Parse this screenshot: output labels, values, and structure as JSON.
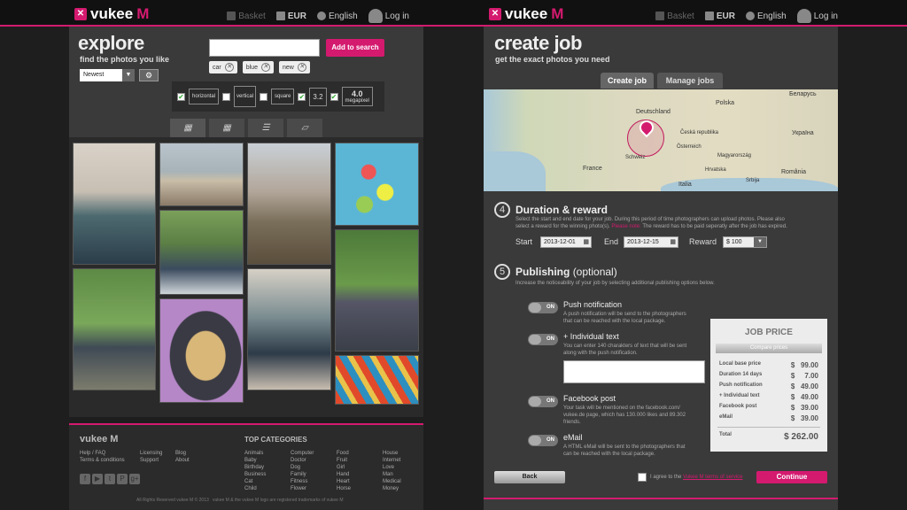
{
  "brand": {
    "name": "vukee",
    "m": "M",
    "mark": "✕",
    "accent": "#d41a6f"
  },
  "nav": {
    "basket": "Basket",
    "currency": "EUR",
    "language": "English",
    "login": "Log in"
  },
  "explore": {
    "title": "explore",
    "subtitle": "find the photos you like",
    "sort": "Newest",
    "search_value": "",
    "search_button": "Add to search",
    "tags": [
      "car",
      "blue",
      "new"
    ],
    "filters": {
      "horizontal": "horizontal",
      "vertical": "vertical",
      "square": "square",
      "ratio": "3.2",
      "megapixel_value": "4.0",
      "megapixel_label": "megapixel"
    }
  },
  "footer": {
    "brand": "vukee M",
    "col1": [
      "Help / FAQ",
      "Terms & conditions"
    ],
    "col2": [
      "Licensing",
      "Support"
    ],
    "col3": [
      "Blog",
      "About"
    ],
    "categories_title": "TOP CATEGORIES",
    "cat1": [
      "Animals",
      "Baby",
      "Birthday",
      "Business",
      "Cat",
      "Child"
    ],
    "cat2": [
      "Computer",
      "Doctor",
      "Dog",
      "Family",
      "Fitness",
      "Flower"
    ],
    "cat3": [
      "Food",
      "Fruit",
      "Girl",
      "Hand",
      "Heart",
      "Horse"
    ],
    "cat4": [
      "House",
      "Internet",
      "Love",
      "Man",
      "Medical",
      "Money"
    ],
    "social": [
      "f",
      "▶",
      "t",
      "P",
      "g+"
    ],
    "copyright": "All Rights Reserved vukee M © 2013",
    "trademark": "vukee M & the vukee M logo are registered trademarks of vukee M"
  },
  "job": {
    "title": "create job",
    "subtitle": "get the exact photos you need",
    "tab_create": "Create job",
    "tab_manage": "Manage jobs",
    "map_labels": [
      "Deutschland",
      "France",
      "Polska",
      "Česká republika",
      "Magyarország",
      "România",
      "Україна",
      "Беларусь",
      "Italia",
      "Schweiz",
      "Österreich",
      "Hrvatska",
      "Srbija"
    ],
    "duration": {
      "step": "4",
      "heading": "Duration & reward",
      "desc1": "Select the start and end date for your job. During this period of time photographers can upload photos. Please also",
      "desc2a": "select a reward for the winning photo(s).",
      "desc2b": "Please note:",
      "desc2c": "The reward has to be paid seperatly after the job has expired.",
      "start_label": "Start",
      "start_value": "2013-12-01",
      "end_label": "End",
      "end_value": "2013-12-15",
      "reward_label": "Reward",
      "reward_value": "$ 100"
    },
    "publishing": {
      "step": "5",
      "heading": "Publishing",
      "heading_opt": "(optional)",
      "desc": "Increase the noticeability of your job by selecting additional publishing options below."
    },
    "options": [
      {
        "toggle": "ON",
        "title": "Push notification",
        "desc": [
          "A push notification will be send to the photographers",
          "that can be reached with the local package."
        ]
      },
      {
        "toggle": "ON",
        "title": "+ Individual text",
        "desc": [
          "You can enter 140 charakters of text that will be sent",
          "along with the push notification."
        ]
      },
      {
        "toggle": "ON",
        "title": "Facebook post",
        "desc": [
          "Your task will be mentioned on the facebook.com/",
          "vukee.de page, which has 130.000 likes and 89.302",
          "friends."
        ]
      },
      {
        "toggle": "ON",
        "title": "eMail",
        "desc": [
          "A HTML eMail will be sent to the photographers that",
          "can be reached with the local package."
        ]
      }
    ],
    "price": {
      "title": "JOB PRICE",
      "compare": "Compare prices",
      "rows": [
        {
          "label": "Local base price",
          "cur": "$",
          "value": "99.00"
        },
        {
          "label": "Duration 14 days",
          "cur": "$",
          "value": "7.00"
        },
        {
          "label": "Push notification",
          "cur": "$",
          "value": "49.00"
        },
        {
          "label": "+ Individual text",
          "cur": "$",
          "value": "49.00"
        },
        {
          "label": "Facebook post",
          "cur": "$",
          "value": "39.00"
        },
        {
          "label": "eMail",
          "cur": "$",
          "value": "39.00"
        }
      ],
      "total_label": "Total",
      "total_value": "$ 262.00"
    },
    "back": "Back",
    "agree_prefix": "I agree to the",
    "agree_link": "Vukee M terms of service",
    "continue": "Continue"
  }
}
